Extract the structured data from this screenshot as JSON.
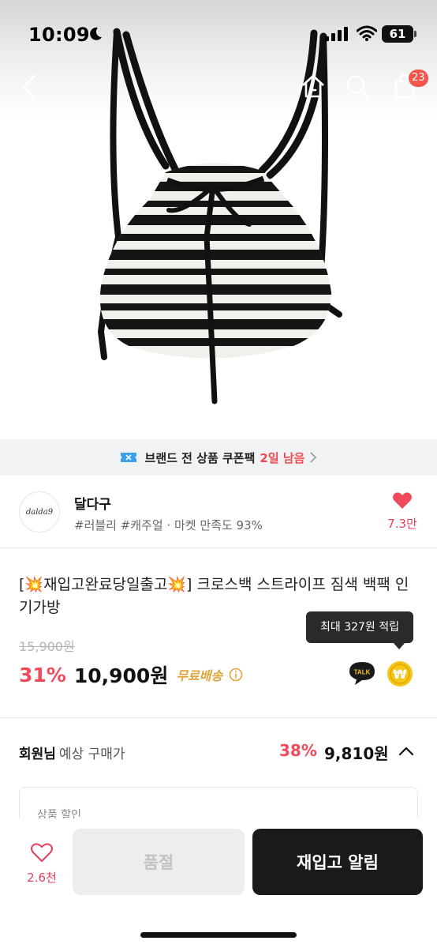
{
  "status_bar": {
    "time": "10:09",
    "battery": "61"
  },
  "nav": {
    "cart_count": "23"
  },
  "coupon_bar": {
    "text": "브랜드 전 상품 쿠폰팩",
    "highlight": "2일 남음"
  },
  "brand": {
    "logo_text": "dalda9",
    "name": "달다구",
    "tags": "#러블리 #캐주얼 · 마켓 만족도 93%",
    "likes": "7.3만"
  },
  "product": {
    "title": "[💥재입고완료당일출고💥] 크로스백 스트라이프 짐색 백팩 인기가방",
    "original_price": "15,900원",
    "discount": "31%",
    "price": "10,900원",
    "shipping": "무료배송",
    "points_tooltip": "최대 327원 적립",
    "talk_label": "TALK",
    "point_symbol": "₩"
  },
  "member_price": {
    "label": "회원님",
    "sub_label": "예상 구매가",
    "discount": "38%",
    "price": "9,810원"
  },
  "discount_box": {
    "label": "상품 할인"
  },
  "bottom_bar": {
    "wish_count": "2.6천",
    "soldout_label": "품절",
    "restock_label": "재입고 알림"
  },
  "colors": {
    "accent_red": "#f04b5a",
    "badge_red": "#f4564b",
    "shipping_gold": "#e0a43a",
    "point_yellow": "#f5c518",
    "dark_button": "#1a1a1a"
  }
}
